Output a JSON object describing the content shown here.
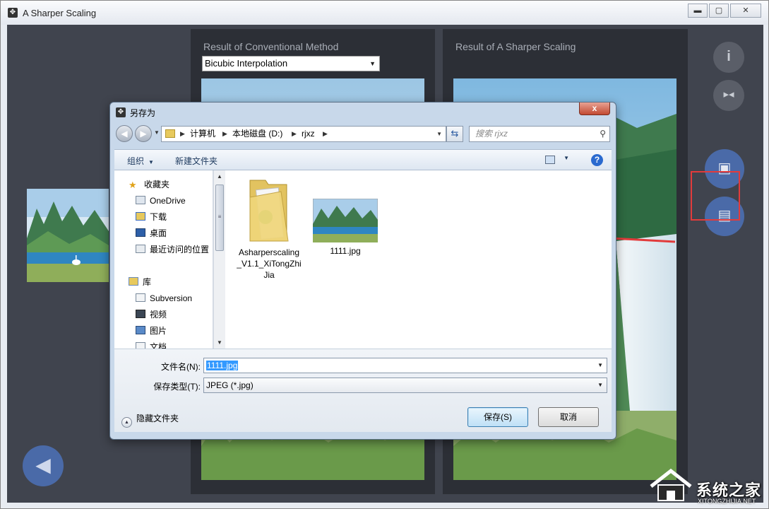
{
  "app": {
    "title": "A Sharper Scaling",
    "window_buttons": [
      "▬",
      "▢",
      "✕"
    ]
  },
  "panels": {
    "left_title": "Result of Conventional Method",
    "method_select": "Bicubic Interpolation",
    "right_title": "Result of  A Sharper Scaling"
  },
  "side_buttons": {
    "info": "i",
    "compare": "▸◂",
    "paste": "▣",
    "save": "▤",
    "back": "◀"
  },
  "dialog": {
    "title": "另存为",
    "close": "x",
    "breadcrumb": [
      "计算机",
      "本地磁盘 (D:)",
      "rjxz"
    ],
    "search_placeholder": "搜索 rjxz",
    "toolbar": {
      "organize": "组织",
      "new_folder": "新建文件夹"
    },
    "nav": {
      "favorites": "收藏夹",
      "favorites_items": [
        "OneDrive",
        "下载",
        "桌面",
        "最近访问的位置"
      ],
      "library": "库",
      "library_items": [
        "Subversion",
        "视频",
        "图片",
        "文档"
      ]
    },
    "files": [
      {
        "name": "Asharperscaling_V1.1_XiTongZhiJia",
        "line1": "Asharperscaling",
        "line2": "_V1.1_XiTongZhi",
        "line3": "Jia",
        "type": "folder"
      },
      {
        "name": "1111.jpg",
        "type": "image"
      }
    ],
    "filename_label": "文件名(N):",
    "filename_value": "1111.jpg",
    "filetype_label": "保存类型(T):",
    "filetype_value": "JPEG (*.jpg)",
    "hide_folders": "隐藏文件夹",
    "save_button": "保存(S)",
    "cancel_button": "取消"
  },
  "watermark": {
    "text": "系统之家",
    "url": "XITONGZHIJIA.NET"
  }
}
